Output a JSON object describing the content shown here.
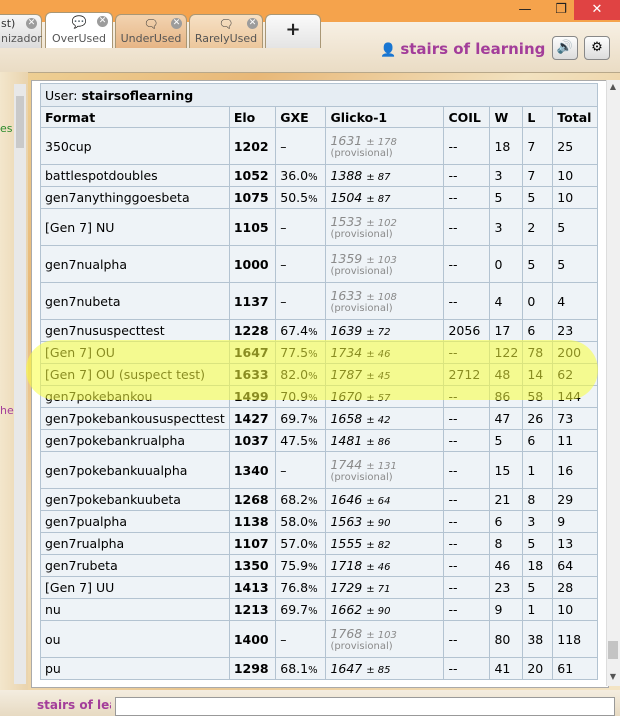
{
  "window": {
    "minimize_label": "—",
    "maximize_label": "❐",
    "close_label": "✕"
  },
  "tabs": [
    {
      "icon": "",
      "label_top": "st)",
      "label": "nizador"
    },
    {
      "icon": "speech-bubble-icon",
      "label": "OverUsed"
    },
    {
      "icon": "speech-bubbles-icon",
      "label": "UnderUsed"
    },
    {
      "icon": "speech-bubble-icon",
      "label": "RarelyUsed"
    },
    {
      "label": "+"
    }
  ],
  "header": {
    "username": "stairs of learning"
  },
  "side_snippets": {
    "green": "es",
    "purple": "hea"
  },
  "ladder": {
    "user_label": "User:",
    "user_id": "stairsoflearning",
    "columns": [
      "Format",
      "Elo",
      "GXE",
      "Glicko-1",
      "COIL",
      "W",
      "L",
      "Total"
    ],
    "rows": [
      {
        "format": "350cup",
        "elo": "1202",
        "gxe": "–",
        "gxe_unit": "",
        "glicko": "1631",
        "dev": "± 178",
        "provisional": "(provisional)",
        "coil": "--",
        "w": "18",
        "l": "7",
        "total": "25"
      },
      {
        "format": "battlespotdoubles",
        "elo": "1052",
        "gxe": "36.0",
        "gxe_unit": "%",
        "glicko": "1388",
        "dev": "± 87",
        "provisional": "",
        "coil": "--",
        "w": "3",
        "l": "7",
        "total": "10"
      },
      {
        "format": "gen7anythinggoesbeta",
        "elo": "1075",
        "gxe": "50.5",
        "gxe_unit": "%",
        "glicko": "1504",
        "dev": "± 87",
        "provisional": "",
        "coil": "--",
        "w": "5",
        "l": "5",
        "total": "10"
      },
      {
        "format": "[Gen 7] NU",
        "elo": "1105",
        "gxe": "–",
        "gxe_unit": "",
        "glicko": "1533",
        "dev": "± 102",
        "provisional": "(provisional)",
        "coil": "--",
        "w": "3",
        "l": "2",
        "total": "5"
      },
      {
        "format": "gen7nualpha",
        "elo": "1000",
        "gxe": "–",
        "gxe_unit": "",
        "glicko": "1359",
        "dev": "± 103",
        "provisional": "(provisional)",
        "coil": "--",
        "w": "0",
        "l": "5",
        "total": "5"
      },
      {
        "format": "gen7nubeta",
        "elo": "1137",
        "gxe": "–",
        "gxe_unit": "",
        "glicko": "1633",
        "dev": "± 108",
        "provisional": "(provisional)",
        "coil": "--",
        "w": "4",
        "l": "0",
        "total": "4"
      },
      {
        "format": "gen7nususpecttest",
        "elo": "1228",
        "gxe": "67.4",
        "gxe_unit": "%",
        "glicko": "1639",
        "dev": "± 72",
        "provisional": "",
        "coil": "2056",
        "w": "17",
        "l": "6",
        "total": "23"
      },
      {
        "format": "[Gen 7] OU",
        "elo": "1647",
        "gxe": "77.5",
        "gxe_unit": "%",
        "glicko": "1734",
        "dev": "± 46",
        "provisional": "",
        "coil": "--",
        "w": "122",
        "l": "78",
        "total": "200"
      },
      {
        "format": "[Gen 7] OU (suspect test)",
        "elo": "1633",
        "gxe": "82.0",
        "gxe_unit": "%",
        "glicko": "1787",
        "dev": "± 45",
        "provisional": "",
        "coil": "2712",
        "w": "48",
        "l": "14",
        "total": "62"
      },
      {
        "format": "gen7pokebankou",
        "elo": "1499",
        "gxe": "70.9",
        "gxe_unit": "%",
        "glicko": "1670",
        "dev": "± 57",
        "provisional": "",
        "coil": "--",
        "w": "86",
        "l": "58",
        "total": "144"
      },
      {
        "format": "gen7pokebankoususpecttest",
        "elo": "1427",
        "gxe": "69.7",
        "gxe_unit": "%",
        "glicko": "1658",
        "dev": "± 42",
        "provisional": "",
        "coil": "--",
        "w": "47",
        "l": "26",
        "total": "73"
      },
      {
        "format": "gen7pokebankrualpha",
        "elo": "1037",
        "gxe": "47.5",
        "gxe_unit": "%",
        "glicko": "1481",
        "dev": "± 86",
        "provisional": "",
        "coil": "--",
        "w": "5",
        "l": "6",
        "total": "11"
      },
      {
        "format": "gen7pokebankuualpha",
        "elo": "1340",
        "gxe": "–",
        "gxe_unit": "",
        "glicko": "1744",
        "dev": "± 131",
        "provisional": "(provisional)",
        "coil": "--",
        "w": "15",
        "l": "1",
        "total": "16"
      },
      {
        "format": "gen7pokebankuubeta",
        "elo": "1268",
        "gxe": "68.2",
        "gxe_unit": "%",
        "glicko": "1646",
        "dev": "± 64",
        "provisional": "",
        "coil": "--",
        "w": "21",
        "l": "8",
        "total": "29"
      },
      {
        "format": "gen7pualpha",
        "elo": "1138",
        "gxe": "58.0",
        "gxe_unit": "%",
        "glicko": "1563",
        "dev": "± 90",
        "provisional": "",
        "coil": "--",
        "w": "6",
        "l": "3",
        "total": "9"
      },
      {
        "format": "gen7rualpha",
        "elo": "1107",
        "gxe": "57.0",
        "gxe_unit": "%",
        "glicko": "1555",
        "dev": "± 82",
        "provisional": "",
        "coil": "--",
        "w": "8",
        "l": "5",
        "total": "13"
      },
      {
        "format": "gen7rubeta",
        "elo": "1350",
        "gxe": "75.9",
        "gxe_unit": "%",
        "glicko": "1718",
        "dev": "± 46",
        "provisional": "",
        "coil": "--",
        "w": "46",
        "l": "18",
        "total": "64"
      },
      {
        "format": "[Gen 7] UU",
        "elo": "1413",
        "gxe": "76.8",
        "gxe_unit": "%",
        "glicko": "1729",
        "dev": "± 71",
        "provisional": "",
        "coil": "--",
        "w": "23",
        "l": "5",
        "total": "28"
      },
      {
        "format": "nu",
        "elo": "1213",
        "gxe": "69.7",
        "gxe_unit": "%",
        "glicko": "1662",
        "dev": "± 90",
        "provisional": "",
        "coil": "--",
        "w": "9",
        "l": "1",
        "total": "10"
      },
      {
        "format": "ou",
        "elo": "1400",
        "gxe": "–",
        "gxe_unit": "",
        "glicko": "1768",
        "dev": "± 103",
        "provisional": "(provisional)",
        "coil": "--",
        "w": "80",
        "l": "38",
        "total": "118"
      },
      {
        "format": "pu",
        "elo": "1298",
        "gxe": "68.1",
        "gxe_unit": "%",
        "glicko": "1647",
        "dev": "± 85",
        "provisional": "",
        "coil": "--",
        "w": "41",
        "l": "20",
        "total": "61"
      }
    ]
  },
  "chat": {
    "name_prefix": "stairs of lear",
    "input_placeholder": ""
  },
  "colors": {
    "accent_name": "#a33d9a",
    "titlebar": "#f5a34c",
    "highlight": "#faff3c"
  }
}
